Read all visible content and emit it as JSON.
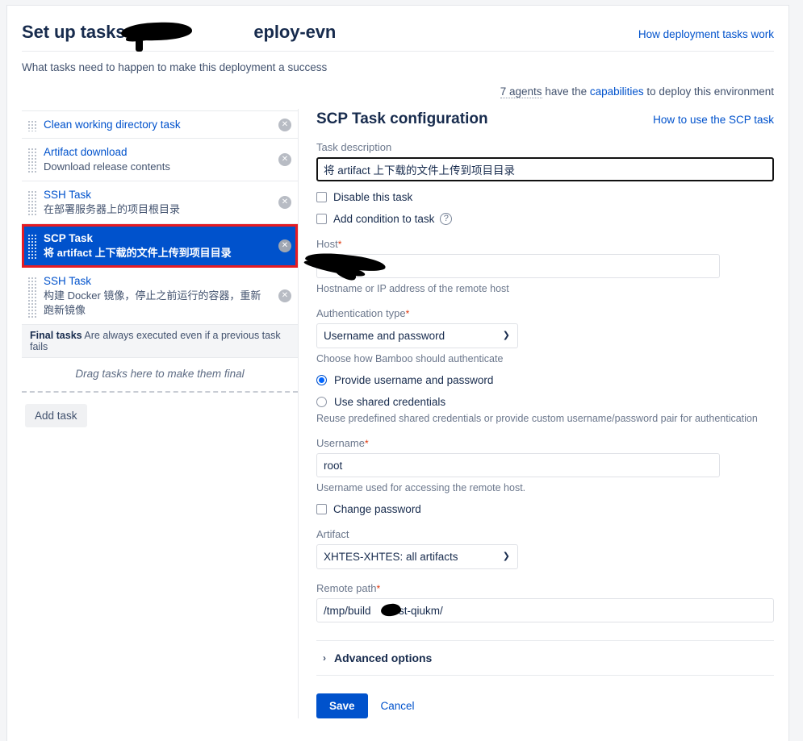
{
  "header": {
    "title_prefix": "Set up tasks:",
    "title_suffix": "eploy-evn",
    "how_link": "How deployment tasks work",
    "subtitle": "What tasks need to happen to make this deployment a success",
    "agents_count": "7 agents",
    "agents_mid": " have the ",
    "agents_link": "capabilities",
    "agents_tail": " to deploy this environment"
  },
  "task_list": {
    "tasks": [
      {
        "title": "Clean working directory task",
        "desc": "",
        "selected": false,
        "delete_icon": "✕"
      },
      {
        "title": "Artifact download",
        "desc": "Download release contents",
        "selected": false,
        "delete_icon": "✕"
      },
      {
        "title": "SSH Task",
        "desc": "在部署服务器上的项目根目录",
        "selected": false,
        "delete_icon": "✕"
      },
      {
        "title": "SCP Task",
        "desc": "将 artifact 上下载的文件上传到项目目录",
        "selected": true,
        "delete_icon": "✕"
      },
      {
        "title": "SSH Task",
        "desc": "构建 Docker 镜像，停止之前运行的容器，重新跑新镜像",
        "selected": false,
        "delete_icon": "✕"
      }
    ],
    "final_bar_bold": "Final tasks",
    "final_bar_text": " Are always executed even if a previous task fails",
    "final_drop_text": "Drag tasks here to make them final",
    "add_task_label": "Add task"
  },
  "config": {
    "title": "SCP Task configuration",
    "help_link": "How to use the SCP task",
    "task_description_label": "Task description",
    "task_description_value": "将 artifact 上下载的文件上传到项目目录",
    "disable_task_label": "Disable this task",
    "add_condition_label": "Add condition to task",
    "help_icon_glyph": "?",
    "host_label": "Host",
    "host_value": "",
    "host_hint": "Hostname or IP address of the remote host",
    "auth_type_label": "Authentication type",
    "auth_type_value": "Username and password",
    "auth_type_options": [
      "Username and password"
    ],
    "auth_type_hint": "Choose how Bamboo should authenticate",
    "radio_provide": "Provide username and password",
    "radio_shared": "Use shared credentials",
    "radio_hint": "Reuse predefined shared credentials or provide custom username/password pair for authentication",
    "username_label": "Username",
    "username_value": "root",
    "username_hint": "Username used for accessing the remote host.",
    "change_password_label": "Change password",
    "artifact_label": "Artifact",
    "artifact_value": "XHTES-XHTES: all artifacts",
    "artifact_options": [
      "XHTES-XHTES: all artifacts"
    ],
    "remote_path_label": "Remote path",
    "remote_path_value": "/tmp/build     -test-qiukm/",
    "advanced_options_label": "Advanced options",
    "advanced_chevron": "›",
    "save_label": "Save",
    "cancel_label": "Cancel",
    "required_marker": "*",
    "dropdown_arrow": "❯"
  },
  "colors": {
    "accent": "#0052CC",
    "selected_row": "#0052CC",
    "highlight_border": "#E51C23",
    "required": "#DE350B",
    "text": "#172B4D",
    "muted": "#6B778C"
  }
}
